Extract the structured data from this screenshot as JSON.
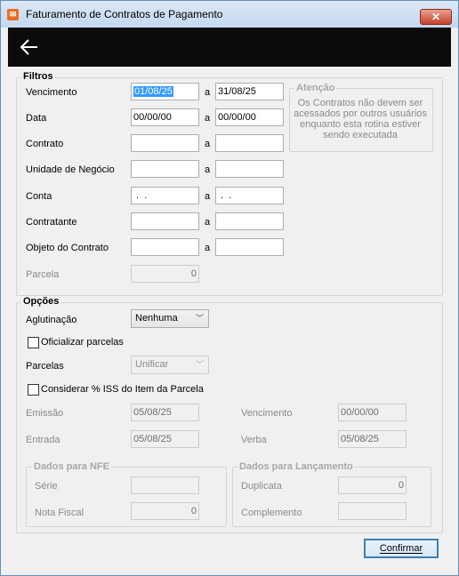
{
  "window": {
    "title": "Faturamento de Contratos de Pagamento",
    "close_label": "✕"
  },
  "toolbar": {
    "back_icon": "arrow-left-icon"
  },
  "filtros": {
    "legend": "Filtros",
    "separator": "a",
    "vencimento": {
      "label": "Vencimento",
      "from": "01/08/25",
      "to": "31/08/25"
    },
    "data": {
      "label": "Data",
      "from": "00/00/00",
      "to": "00/00/00"
    },
    "contrato": {
      "label": "Contrato",
      "from": "",
      "to": ""
    },
    "unidade": {
      "label": "Unidade de Negócio",
      "from": "",
      "to": ""
    },
    "conta": {
      "label": "Conta",
      "from": " .  .",
      "to": " .  ."
    },
    "contratante": {
      "label": "Contratante",
      "from": "",
      "to": ""
    },
    "objeto": {
      "label": "Objeto do Contrato",
      "from": "",
      "to": ""
    },
    "parcela": {
      "label": "Parcela",
      "value": "0"
    },
    "atencao": {
      "legend": "Atenção",
      "text": "Os Contratos não devem ser acessados por outros usuários enquanto esta rotina estiver sendo executada"
    }
  },
  "opcoes": {
    "legend": "Opções",
    "aglutinacao": {
      "label": "Aglutinação",
      "value": "Nenhuma"
    },
    "oficializar": {
      "label": "Oficializar parcelas",
      "checked": false
    },
    "parcelas": {
      "label": "Parcelas",
      "value": "Unificar"
    },
    "considerar_iss": {
      "label": "Considerar % ISS do Item da Parcela",
      "checked": false
    },
    "emissao": {
      "label": "Emissão",
      "value": "05/08/25"
    },
    "vencimento": {
      "label": "Vencimento",
      "value": "00/00/00"
    },
    "entrada": {
      "label": "Entrada",
      "value": "05/08/25"
    },
    "verba": {
      "label": "Verba",
      "value": "05/08/25"
    },
    "nfe": {
      "legend": "Dados para NFE",
      "serie_label": "Série",
      "serie": "",
      "nota_label": "Nota Fiscal",
      "nota": "0"
    },
    "lancamento": {
      "legend": "Dados para Lançamento",
      "duplicata_label": "Duplicata",
      "duplicata": "0",
      "complemento_label": "Complemento",
      "complemento": ""
    }
  },
  "footer": {
    "confirm_label": "Confirmar"
  },
  "colors": {
    "titlebar": "#c4d8ef",
    "toolbar": "#0b0b0b",
    "selection": "#3399ff",
    "close": "#c7402a"
  }
}
